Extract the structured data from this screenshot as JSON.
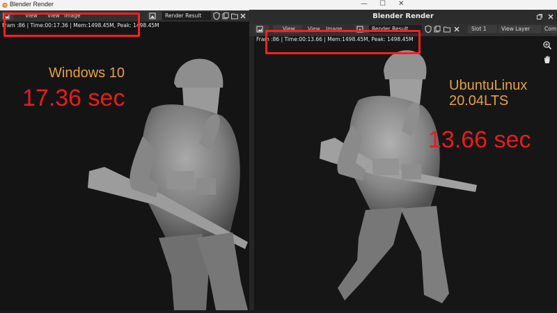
{
  "left_window": {
    "title": "Blender Render",
    "header": {
      "view_menu": "View",
      "view2_menu": "View",
      "image_menu": "Image",
      "image_name": "Render Result"
    },
    "info_text": "Fram :86 | Time:00:17.36 | Mem:1498.45M, Peak: 1498.45M",
    "os_label": "Windows 10",
    "render_time": "17.36 sec"
  },
  "window_controls": {
    "minimize": "—",
    "maximize": "☐",
    "close": "✕"
  },
  "right_window": {
    "title": "Blender Render",
    "header": {
      "view_menu": "View",
      "view2_menu": "View",
      "image_menu": "Image",
      "image_name": "Render Result",
      "slot": "Slot 1",
      "view_layer": "View Layer",
      "composite": "Com"
    },
    "info_text": "Fram :86 | Time:00:13.66 | Mem:1498.45M, Peak: 1498.45M",
    "os_label_line1": "UbuntuLinux",
    "os_label_line2": "20.04LTS",
    "render_time": "13.66 sec"
  },
  "colors": {
    "highlight_box": "#ff1f1f",
    "os_label": "#e6a238",
    "time_label": "#e81c1c"
  }
}
